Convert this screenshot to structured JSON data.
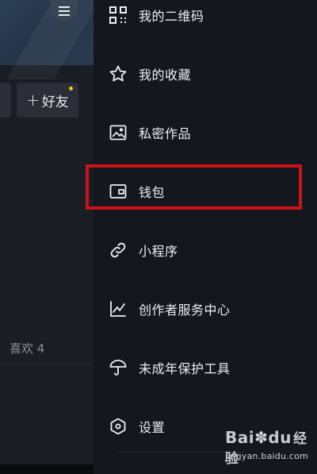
{
  "left": {
    "add_friend_label": "好友",
    "add_friend_plus": "+",
    "like_tab_label": "喜欢 4"
  },
  "drawer": {
    "items": [
      {
        "label": "我的二维码",
        "icon": "qr-code-icon"
      },
      {
        "label": "我的收藏",
        "icon": "star-icon"
      },
      {
        "label": "私密作品",
        "icon": "private-works-icon"
      },
      {
        "label": "钱包",
        "icon": "wallet-icon"
      },
      {
        "label": "小程序",
        "icon": "link-icon"
      },
      {
        "label": "创作者服务中心",
        "icon": "chart-icon"
      },
      {
        "label": "未成年保护工具",
        "icon": "umbrella-icon"
      },
      {
        "label": "设置",
        "icon": "settings-hexagon-icon"
      }
    ],
    "highlighted_item": "钱包"
  },
  "watermark": {
    "logo_text": "Bai",
    "logo_text_2": "du",
    "logo_text_3": "经验",
    "url": "jingyan.baidu.com"
  },
  "colors": {
    "background": "#15171e",
    "highlight_border": "#cc1119",
    "badge_dot": "#f7c13a"
  }
}
